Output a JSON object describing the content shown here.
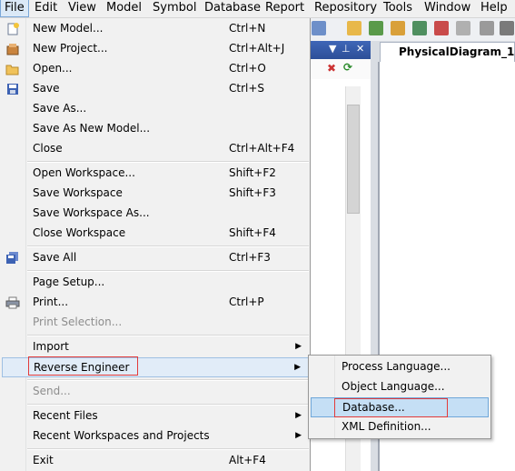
{
  "menubar": {
    "items": [
      "File",
      "Edit",
      "View",
      "Model",
      "Symbol",
      "Database",
      "Report",
      "Repository",
      "Tools",
      "Window",
      "Help"
    ]
  },
  "diagram": {
    "tab_title": "PhysicalDiagram_1"
  },
  "file_menu": {
    "new_model": {
      "label": "New Model...",
      "shortcut": "Ctrl+N"
    },
    "new_project": {
      "label": "New Project...",
      "shortcut": "Ctrl+Alt+J"
    },
    "open": {
      "label": "Open...",
      "shortcut": "Ctrl+O"
    },
    "save": {
      "label": "Save",
      "shortcut": "Ctrl+S"
    },
    "save_as": {
      "label": "Save As..."
    },
    "save_as_new_model": {
      "label": "Save As New Model..."
    },
    "close": {
      "label": "Close",
      "shortcut": "Ctrl+Alt+F4"
    },
    "open_workspace": {
      "label": "Open Workspace...",
      "shortcut": "Shift+F2"
    },
    "save_workspace": {
      "label": "Save Workspace",
      "shortcut": "Shift+F3"
    },
    "save_workspace_as": {
      "label": "Save Workspace As..."
    },
    "close_workspace": {
      "label": "Close Workspace",
      "shortcut": "Shift+F4"
    },
    "save_all": {
      "label": "Save All",
      "shortcut": "Ctrl+F3"
    },
    "page_setup": {
      "label": "Page Setup..."
    },
    "print": {
      "label": "Print...",
      "shortcut": "Ctrl+P"
    },
    "print_selection": {
      "label": "Print Selection..."
    },
    "import": {
      "label": "Import"
    },
    "reverse_engineer": {
      "label": "Reverse Engineer"
    },
    "send": {
      "label": "Send..."
    },
    "recent_files": {
      "label": "Recent Files"
    },
    "recent_workspaces": {
      "label": "Recent Workspaces and Projects"
    },
    "exit": {
      "label": "Exit",
      "shortcut": "Alt+F4"
    }
  },
  "reverse_engineer_submenu": {
    "process_language": "Process Language...",
    "object_language": "Object Language...",
    "database": "Database...",
    "xml_definition": "XML Definition..."
  },
  "colors": {
    "highlight": "#c5dff5",
    "annotation_box": "#e23b3b",
    "panel_header": "#2d4f98"
  }
}
